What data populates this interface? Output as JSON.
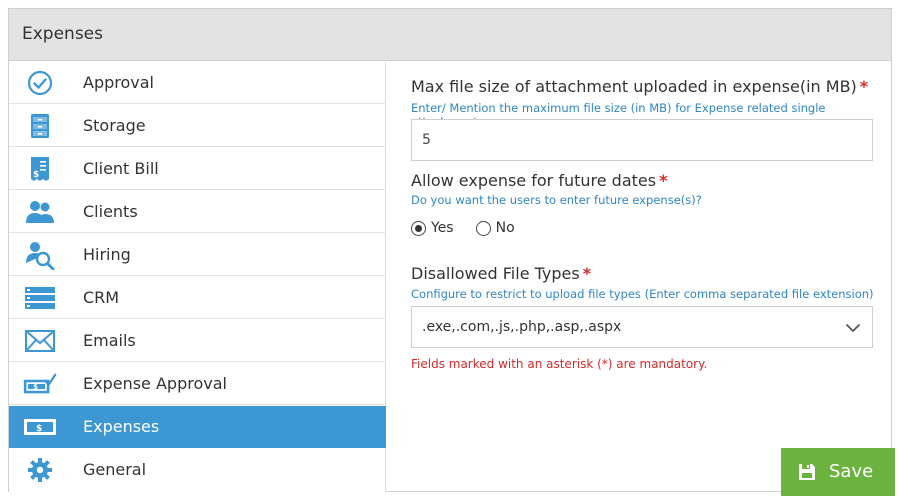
{
  "panel": {
    "title": "Expenses"
  },
  "sidebar": {
    "items": [
      {
        "label": "Approval",
        "icon": "check-circle-icon"
      },
      {
        "label": "Storage",
        "icon": "cabinet-icon"
      },
      {
        "label": "Client Bill",
        "icon": "bill-icon"
      },
      {
        "label": "Clients",
        "icon": "clients-icon"
      },
      {
        "label": "Hiring",
        "icon": "hiring-icon"
      },
      {
        "label": "CRM",
        "icon": "crm-icon"
      },
      {
        "label": "Emails",
        "icon": "envelope-icon"
      },
      {
        "label": "Expense Approval",
        "icon": "expense-approval-icon"
      },
      {
        "label": "Expenses",
        "icon": "money-icon",
        "active": true
      },
      {
        "label": "General",
        "icon": "gear-icon"
      }
    ]
  },
  "form": {
    "max_size": {
      "label": "Max file size of attachment uploaded in expense(in MB)",
      "required_mark": "*",
      "help": "Enter/ Mention the maximum file size (in MB) for Expense related single attachment.",
      "value": "5"
    },
    "future_dates": {
      "label": "Allow expense for future dates",
      "required_mark": "*",
      "help": "Do you want the users to enter future expense(s)?",
      "options": [
        {
          "label": "Yes",
          "selected": true
        },
        {
          "label": "No",
          "selected": false
        }
      ]
    },
    "disallowed": {
      "label": "Disallowed File Types",
      "required_mark": "*",
      "help": "Configure to restrict to upload file types (Enter comma separated file extension)",
      "value": ".exe,.com,.js,.php,.asp,.aspx"
    },
    "mandatory_note": "Fields marked with an asterisk (*) are mandatory.",
    "save_label": "Save"
  },
  "colors": {
    "accent": "#3d97d3",
    "save": "#6bb33e",
    "required": "#d42a2a",
    "help": "#2f86c4"
  }
}
